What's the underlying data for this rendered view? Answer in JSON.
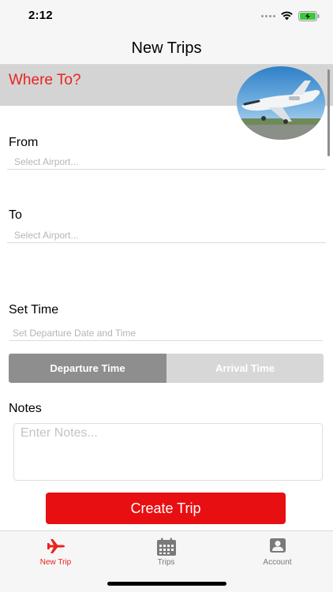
{
  "status_bar": {
    "time": "2:12"
  },
  "nav": {
    "title": "New Trips"
  },
  "header": {
    "where_to": "Where To?"
  },
  "form": {
    "from_label": "From",
    "from_placeholder": "Select Airport...",
    "to_label": "To",
    "to_placeholder": "Select Airport...",
    "time_label": "Set Time",
    "time_placeholder": "Set Departure Date and Time",
    "segment": {
      "departure": "Departure Time",
      "arrival": "Arrival Time",
      "selected": "Departure Time"
    },
    "notes_label": "Notes",
    "notes_placeholder": "Enter Notes..."
  },
  "actions": {
    "create_trip": "Create Trip"
  },
  "tab_bar": {
    "items": [
      {
        "label": "New Trip",
        "icon": "airplane-icon",
        "active": true
      },
      {
        "label": "Trips",
        "icon": "calendar-icon",
        "active": false
      },
      {
        "label": "Account",
        "icon": "account-icon",
        "active": false
      }
    ]
  },
  "colors": {
    "accent": "#e8231f",
    "button": "#e80f12",
    "segment_selected": "#8e8e8e",
    "segment_unselected": "#d7d7d7",
    "header_band": "#d4d4d4"
  }
}
